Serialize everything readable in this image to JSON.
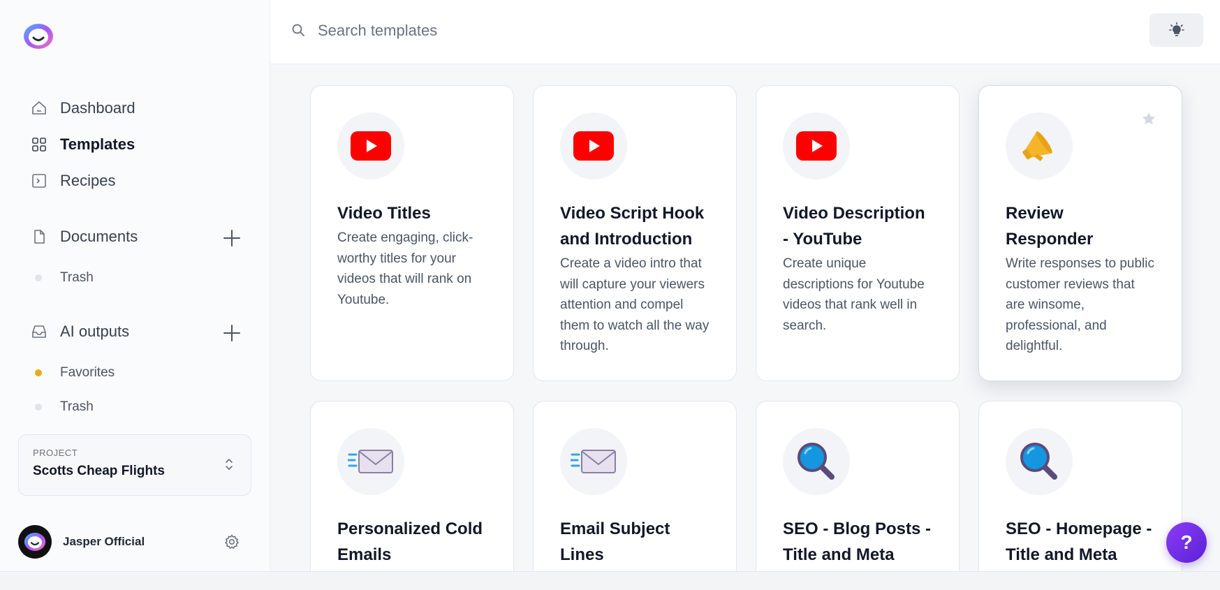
{
  "sidebar": {
    "nav": [
      {
        "label": "Dashboard",
        "icon": "home-icon"
      },
      {
        "label": "Templates",
        "icon": "grid-icon"
      },
      {
        "label": "Recipes",
        "icon": "terminal-icon"
      }
    ],
    "documents": {
      "label": "Documents",
      "icon": "document-icon",
      "items": [
        {
          "label": "Trash"
        }
      ]
    },
    "ai_outputs": {
      "label": "AI outputs",
      "icon": "inbox-icon",
      "items": [
        {
          "label": "Favorites",
          "color": "#e5ae1c"
        },
        {
          "label": "Trash"
        }
      ]
    },
    "project": {
      "label": "PROJECT",
      "name": "Scotts Cheap Flights"
    },
    "user": {
      "name": "Jasper Official"
    }
  },
  "header": {
    "search_placeholder": "Search templates"
  },
  "cards": [
    {
      "title": "Video Titles",
      "description": "Create engaging, click-worthy titles for your videos that will rank on Youtube.",
      "icon": "youtube-icon"
    },
    {
      "title": "Video Script Hook and Introduction",
      "description": "Create a video intro that will capture your viewers attention and compel them to watch all the way through.",
      "icon": "youtube-icon"
    },
    {
      "title": "Video Description - YouTube",
      "description": "Create unique descriptions for Youtube videos that rank well in search.",
      "icon": "youtube-icon"
    },
    {
      "title": "Review Responder",
      "description": "Write responses to public customer reviews that are winsome, professional, and delightful.",
      "icon": "megaphone-icon"
    },
    {
      "title": "Personalized Cold Emails",
      "description": "",
      "icon": "envelope-icon"
    },
    {
      "title": "Email Subject Lines",
      "description": "",
      "icon": "envelope-icon"
    },
    {
      "title": "SEO - Blog Posts - Title and Meta",
      "description": "",
      "icon": "magnifier-icon"
    },
    {
      "title": "SEO - Homepage - Title and Meta",
      "description": "",
      "icon": "magnifier-icon"
    }
  ],
  "help_label": "?",
  "colors": {
    "accent": "#7c3aed",
    "youtube": "#ff0000",
    "favorite": "#e5ae1c"
  }
}
